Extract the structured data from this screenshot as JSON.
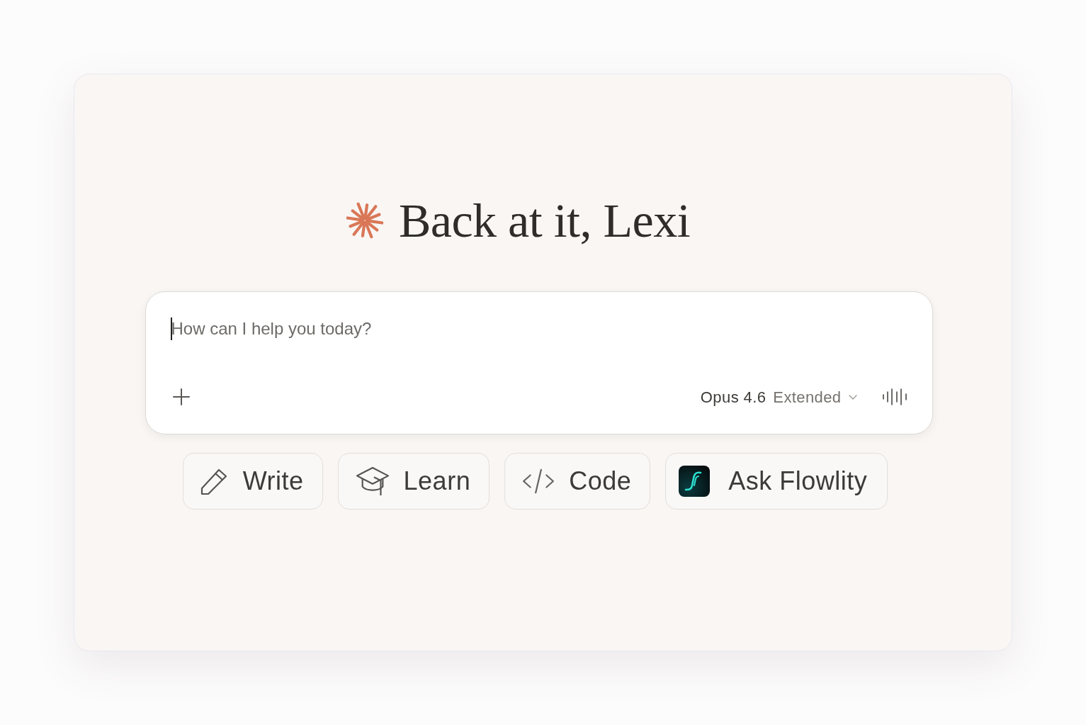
{
  "greeting": {
    "text": "Back at it, Lexi"
  },
  "composer": {
    "placeholder": "How can I help you today?",
    "focused": true,
    "model": "Opus 4.6",
    "mode": "Extended"
  },
  "shortcuts": [
    {
      "kind": "write",
      "label": "Write"
    },
    {
      "kind": "learn",
      "label": "Learn"
    },
    {
      "kind": "code",
      "label": "Code"
    },
    {
      "kind": "app",
      "label": "Ask Flowlity"
    }
  ]
}
